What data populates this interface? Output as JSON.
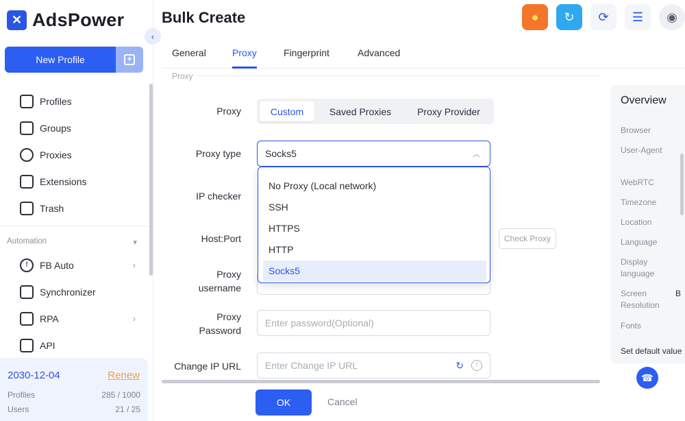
{
  "brand": {
    "name": "AdsPower"
  },
  "sidebar": {
    "new_profile": "New Profile",
    "items": [
      {
        "label": "Profiles",
        "icon": "profiles-icon"
      },
      {
        "label": "Groups",
        "icon": "folder-icon"
      },
      {
        "label": "Proxies",
        "icon": "globe-icon"
      },
      {
        "label": "Extensions",
        "icon": "puzzle-icon"
      },
      {
        "label": "Trash",
        "icon": "trash-icon"
      }
    ],
    "automation_label": "Automation",
    "automation_items": [
      {
        "label": "FB Auto",
        "icon": "facebook-icon"
      },
      {
        "label": "Synchronizer",
        "icon": "sync-icon"
      },
      {
        "label": "RPA",
        "icon": "robot-icon"
      },
      {
        "label": "API",
        "icon": "api-icon"
      }
    ]
  },
  "subscription": {
    "date": "2030-12-04",
    "renew": "Renew",
    "profiles_label": "Profiles",
    "profiles_value": "285 / 1000",
    "users_label": "Users",
    "users_value": "21 / 25"
  },
  "header": {
    "title": "Bulk Create"
  },
  "tabs": [
    {
      "label": "General"
    },
    {
      "label": "Proxy"
    },
    {
      "label": "Fingerprint"
    },
    {
      "label": "Advanced"
    }
  ],
  "form": {
    "section_label": "Proxy",
    "proxy_label": "Proxy",
    "proxy_options": [
      "Custom",
      "Saved Proxies",
      "Proxy Provider"
    ],
    "proxy_type_label": "Proxy type",
    "proxy_type_value": "Socks5",
    "ip_checker_label": "IP checker",
    "host_port_label": "Host:Port",
    "check_proxy": "Check Proxy",
    "proxy_username_label_1": "Proxy",
    "proxy_username_label_2": "username",
    "proxy_password_label_1": "Proxy",
    "proxy_password_label_2": "Password",
    "proxy_password_placeholder": "Enter password(Optional)",
    "change_ip_label": "Change IP URL",
    "change_ip_placeholder": "Enter Change IP URL"
  },
  "dropdown": {
    "options": [
      "No Proxy (Local network)",
      "SSH",
      "HTTPS",
      "HTTP",
      "Socks5"
    ],
    "selected": "Socks5"
  },
  "overview": {
    "title": "Overview",
    "items": [
      "Browser",
      "User-Agent",
      "WebRTC",
      "Timezone",
      "Location",
      "Language",
      "Display language",
      "Screen Resolution",
      "Fonts",
      "Set default value"
    ],
    "screen_value": "B"
  },
  "footer": {
    "ok": "OK",
    "cancel": "Cancel"
  },
  "colors": {
    "accent": "#2a55e6",
    "renew": "#f4a23a"
  }
}
